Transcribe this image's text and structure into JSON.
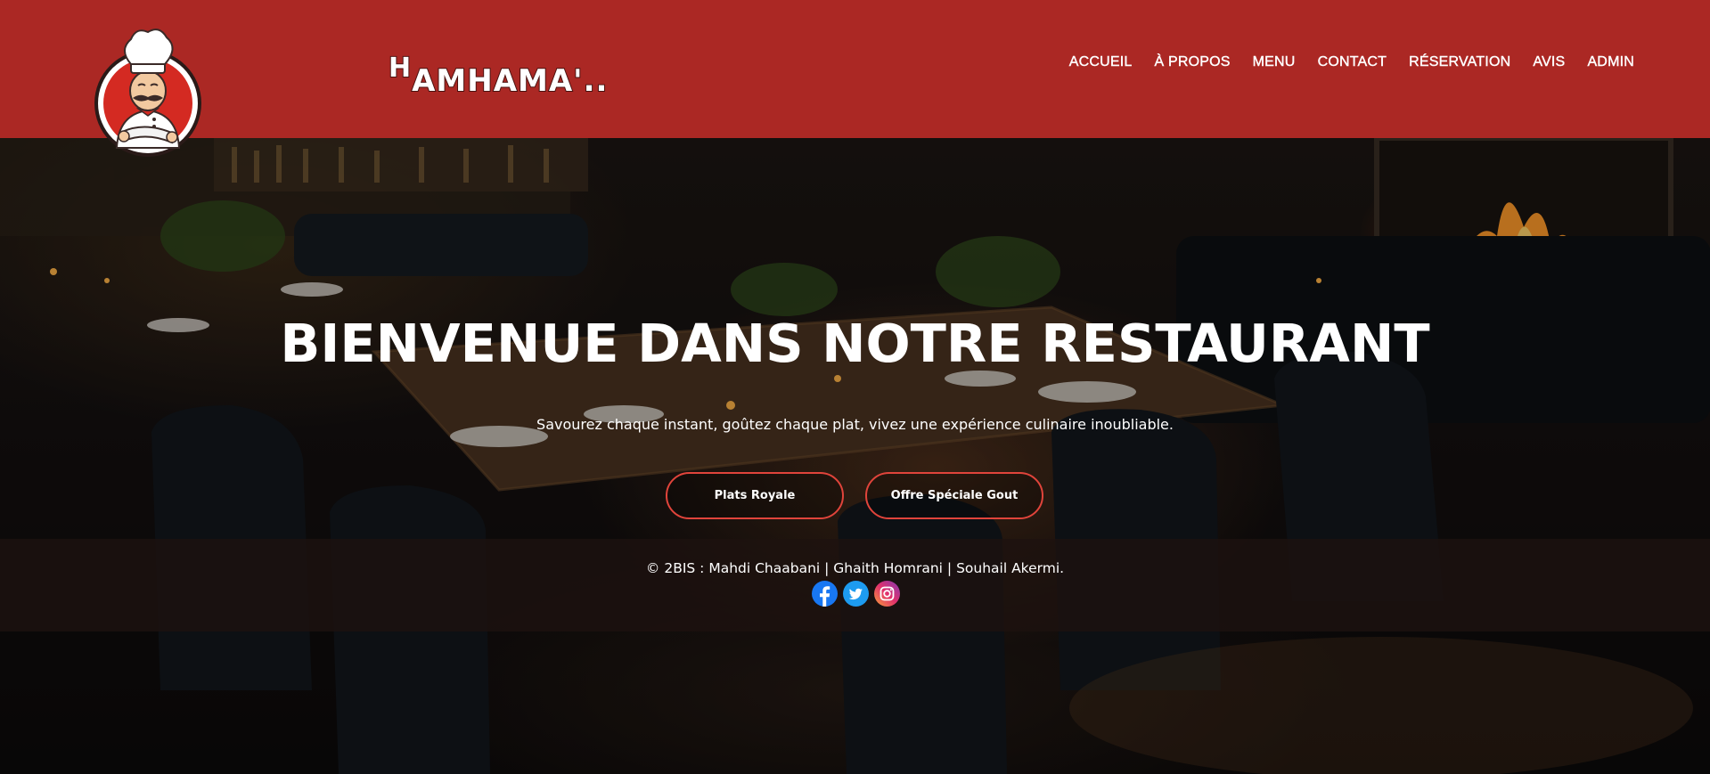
{
  "header": {
    "brand_cap": "H",
    "brand_rest": "AMHAMA'..",
    "nav": [
      {
        "label": "ACCUEIL"
      },
      {
        "label": "À PROPOS"
      },
      {
        "label": "MENU"
      },
      {
        "label": "CONTACT"
      },
      {
        "label": "RÉSERVATION"
      },
      {
        "label": "AVIS"
      },
      {
        "label": "ADMIN"
      }
    ],
    "logo_icon": "chef-mascot-logo",
    "colors": {
      "header_bg": "#ab2824",
      "logo_ring": "#d42a22"
    }
  },
  "hero": {
    "title": "BIENVENUE DANS NOTRE RESTAURANT",
    "subtitle": "Savourez chaque instant, goûtez chaque plat, vivez une expérience culinaire inoubliable.",
    "buttons": [
      {
        "label": "Plats Royale"
      },
      {
        "label": "Offre Spéciale Gout"
      }
    ],
    "button_border_color": "#e0443b"
  },
  "footer": {
    "copyright": "© 2BIS : Mahdi Chaabani | Ghaith Homrani | Souhail Akermi.",
    "socials": [
      {
        "icon": "facebook-icon",
        "color": "#1877f2"
      },
      {
        "icon": "twitter-icon",
        "color": "#1d9bf0"
      },
      {
        "icon": "instagram-icon",
        "color": "#c13584"
      }
    ]
  }
}
